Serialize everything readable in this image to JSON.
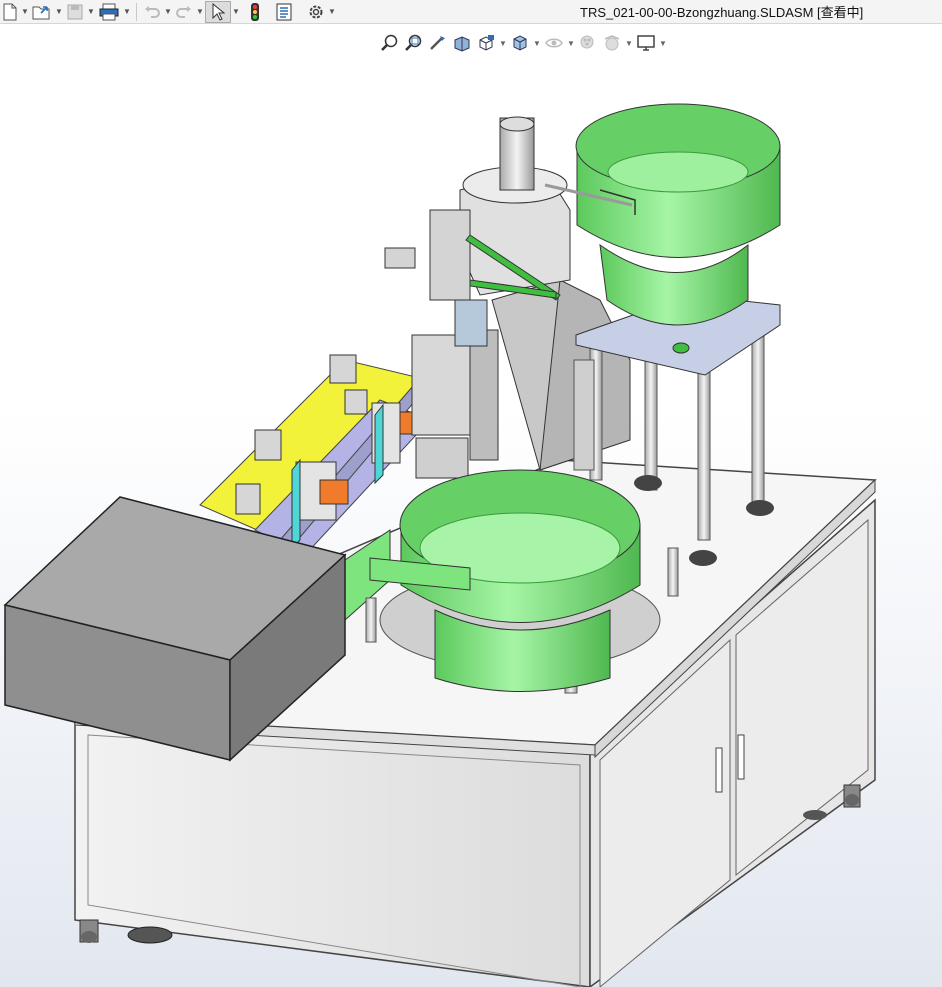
{
  "window": {
    "title": "TRS_021-00-00-Bzongzhuang.SLDASM [查看中]"
  },
  "toolbar": {
    "items": [
      {
        "icon": "new-document-icon",
        "has_dropdown": true
      },
      {
        "icon": "open-folder-icon",
        "has_dropdown": true
      },
      {
        "icon": "save-icon",
        "has_dropdown": true,
        "disabled": true
      },
      {
        "icon": "print-icon",
        "has_dropdown": true
      },
      {
        "icon": "undo-icon",
        "has_dropdown": true,
        "disabled": true
      },
      {
        "icon": "redo-icon",
        "has_dropdown": true,
        "disabled": true
      },
      {
        "icon": "select-pointer-icon",
        "has_dropdown": true,
        "active": true
      },
      {
        "icon": "rebuild-traffic-light-icon",
        "has_dropdown": false
      },
      {
        "icon": "file-properties-icon",
        "has_dropdown": false
      },
      {
        "icon": "options-gear-icon",
        "has_dropdown": true
      }
    ]
  },
  "headsup_toolbar": {
    "items": [
      {
        "icon": "zoom-to-fit-icon"
      },
      {
        "icon": "zoom-to-area-icon"
      },
      {
        "icon": "previous-view-icon"
      },
      {
        "icon": "section-view-icon"
      },
      {
        "icon": "view-orientation-icon",
        "has_dropdown": true
      },
      {
        "icon": "display-style-icon",
        "has_dropdown": true
      },
      {
        "icon": "hide-show-items-icon",
        "has_dropdown": true,
        "disabled": true
      },
      {
        "icon": "edit-appearance-icon",
        "disabled": true
      },
      {
        "icon": "apply-scene-icon",
        "has_dropdown": true,
        "disabled": true
      },
      {
        "icon": "view-settings-icon",
        "has_dropdown": true
      }
    ]
  },
  "colors": {
    "toolbar_bg": "#f4f4f4",
    "bowl_green": "#7ee47e",
    "bowl_green_dark": "#4fb84f",
    "yellow_plate": "#f2f23a",
    "lavender_plate": "#b3b3e6",
    "cabinet": "#ececec",
    "cabinet_edge": "#555555",
    "gray_box": "#9a9a9a",
    "orange_part": "#f07b2a",
    "cyan_part": "#4fd6d6"
  }
}
